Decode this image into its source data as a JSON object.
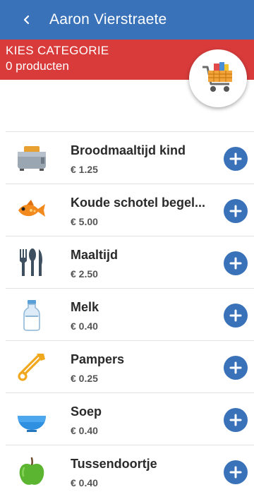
{
  "app_bar": {
    "title": "Aaron Vierstraete",
    "back_icon": "chevron-left-icon",
    "color": "#3a72b9"
  },
  "category": {
    "title": "KIES CATEGORIE",
    "count_text": "0 producten",
    "color": "#d93b3b"
  },
  "cart": {
    "icon": "shopping-cart-icon"
  },
  "products": [
    {
      "name": "Broodmaaltijd kind",
      "price": "€ 1.25",
      "icon": "toaster-icon"
    },
    {
      "name": "Koude schotel begel...",
      "price": "€ 5.00",
      "icon": "fish-icon"
    },
    {
      "name": "Maaltijd",
      "price": "€ 2.50",
      "icon": "cutlery-icon"
    },
    {
      "name": "Melk",
      "price": "€ 0.40",
      "icon": "milk-bottle-icon"
    },
    {
      "name": "Pampers",
      "price": "€ 0.25",
      "icon": "safety-pin-icon"
    },
    {
      "name": "Soep",
      "price": "€ 0.40",
      "icon": "soup-bowl-icon"
    },
    {
      "name": "Tussendoortje",
      "price": "€ 0.40",
      "icon": "apple-icon"
    }
  ]
}
